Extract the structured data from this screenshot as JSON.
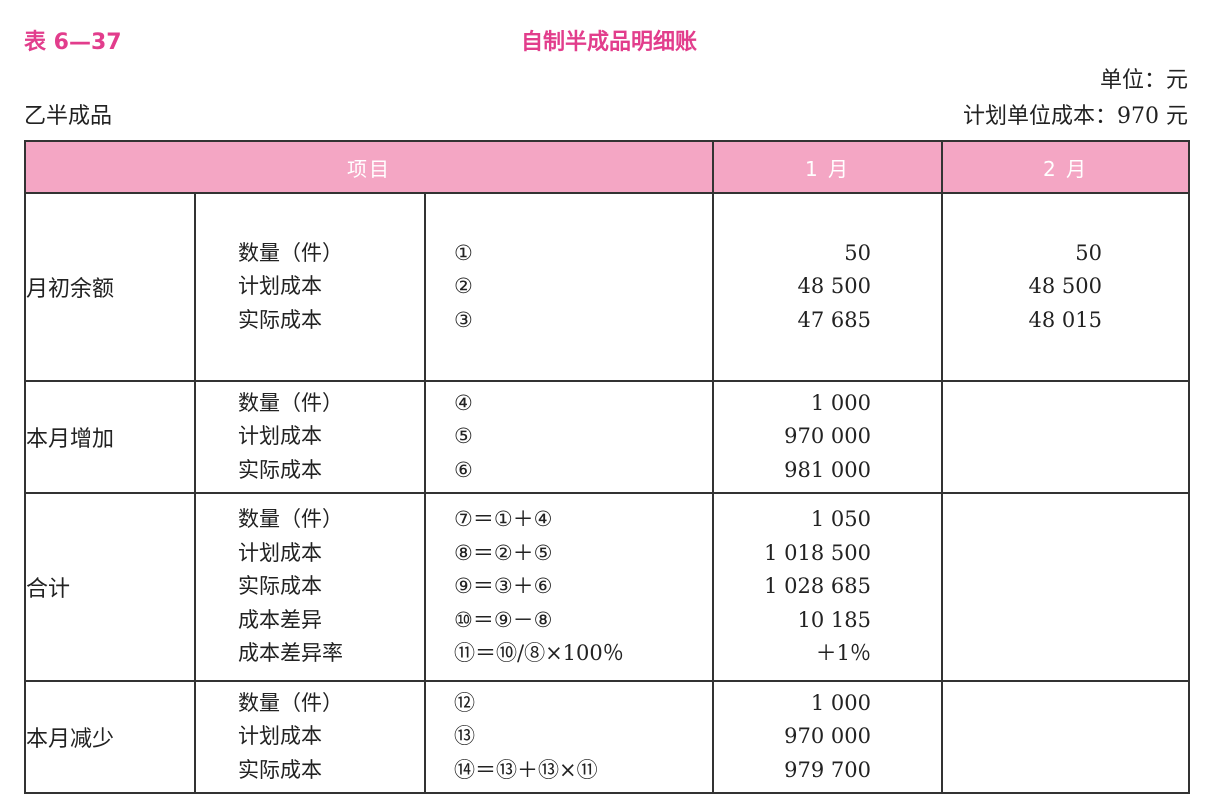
{
  "caption": {
    "label": "表 6—37",
    "title": "自制半成品明细账"
  },
  "unit": "单位：元",
  "product": "乙半成品",
  "plan_unit_cost": "计划单位成本：970 元",
  "header": {
    "item": "项目",
    "month1": "1 月",
    "month2": "2 月"
  },
  "groups": [
    {
      "name": "月初余额",
      "rows": [
        {
          "item": "数量（件）",
          "formula": "①",
          "m1": "50",
          "m2": "50"
        },
        {
          "item": "计划成本",
          "formula": "②",
          "m1": "48 500",
          "m2": "48 500"
        },
        {
          "item": "实际成本",
          "formula": "③",
          "m1": "47 685",
          "m2": "48 015"
        }
      ]
    },
    {
      "name": "本月增加",
      "rows": [
        {
          "item": "数量（件）",
          "formula": "④",
          "m1": "1 000",
          "m2": ""
        },
        {
          "item": "计划成本",
          "formula": "⑤",
          "m1": "970 000",
          "m2": ""
        },
        {
          "item": "实际成本",
          "formula": "⑥",
          "m1": "981 000",
          "m2": ""
        }
      ]
    },
    {
      "name": "合计",
      "rows": [
        {
          "item": "数量（件）",
          "formula": "⑦＝①＋④",
          "m1": "1 050",
          "m2": ""
        },
        {
          "item": "计划成本",
          "formula": "⑧＝②＋⑤",
          "m1": "1 018 500",
          "m2": ""
        },
        {
          "item": "实际成本",
          "formula": "⑨＝③＋⑥",
          "m1": "1 028 685",
          "m2": ""
        },
        {
          "item": "成本差异",
          "formula": "⑩＝⑨－⑧",
          "m1": "10 185",
          "m2": ""
        },
        {
          "item": "成本差异率",
          "formula": "⑪＝⑩/⑧×100％",
          "m1": "＋1％",
          "m2": ""
        }
      ]
    },
    {
      "name": "本月减少",
      "rows": [
        {
          "item": "数量（件）",
          "formula": "⑫",
          "m1": "1 000",
          "m2": ""
        },
        {
          "item": "计划成本",
          "formula": "⑬",
          "m1": "970 000",
          "m2": ""
        },
        {
          "item": "实际成本",
          "formula": "⑭＝⑬＋⑬×⑪",
          "m1": "979 700",
          "m2": ""
        }
      ]
    }
  ],
  "colors": {
    "accent": "#e23d8c",
    "header_bg": "#f4a6c4"
  }
}
